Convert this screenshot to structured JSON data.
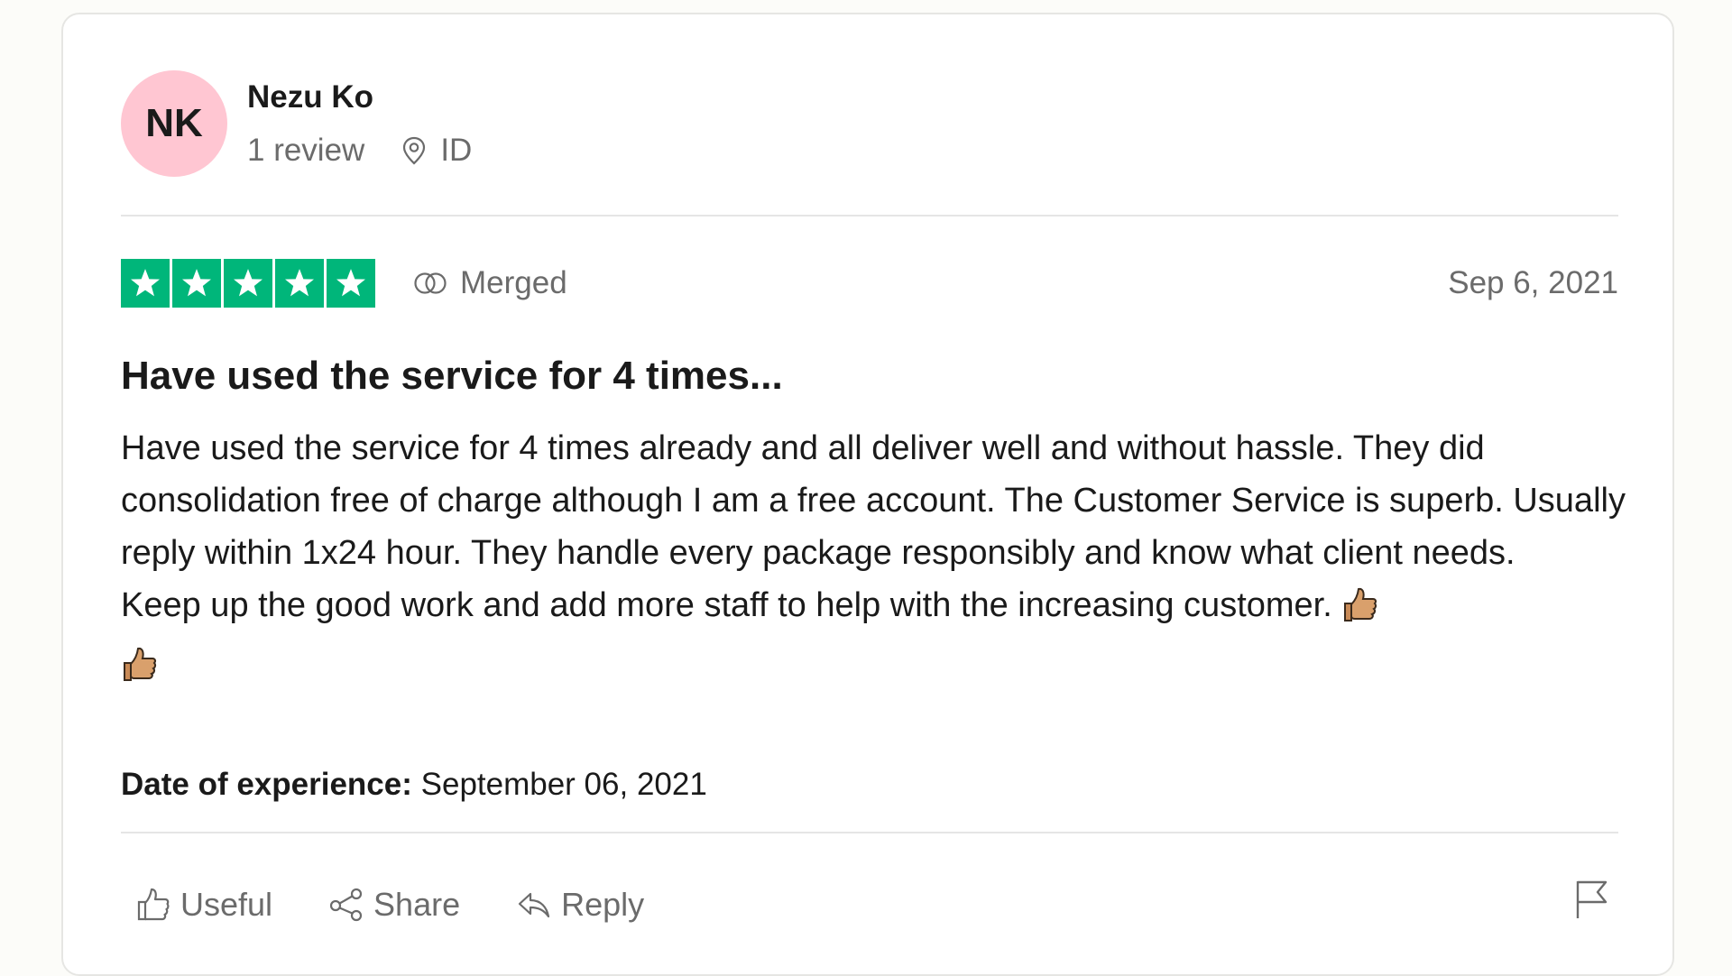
{
  "reviewer": {
    "initials": "NK",
    "name": "Nezu Ko",
    "review_count": "1 review",
    "location": "ID",
    "avatar_color": "#ffc6d2"
  },
  "rating": {
    "stars": 5,
    "max_stars": 5,
    "star_color": "#00b67a",
    "merged_label": "Merged",
    "date": "Sep 6, 2021"
  },
  "review": {
    "title": "Have used the service for 4 times...",
    "body_lines": [
      "Have used the service for 4 times already and all deliver well and without hassle. They did consolidation free of charge although I am a free account. The Customer Service is superb. Usually reply within 1x24 hour. They handle every package responsibly and know what client needs.",
      "Keep up the good work and add more staff to help with the increasing customer."
    ],
    "emoji_icons": [
      "thumbs-up-emoji",
      "thumbs-up-emoji"
    ]
  },
  "experience": {
    "label": "Date of experience:",
    "value": " September 06, 2021"
  },
  "actions": {
    "useful": "Useful",
    "share": "Share",
    "reply": "Reply",
    "flag_icon": "flag-icon"
  }
}
